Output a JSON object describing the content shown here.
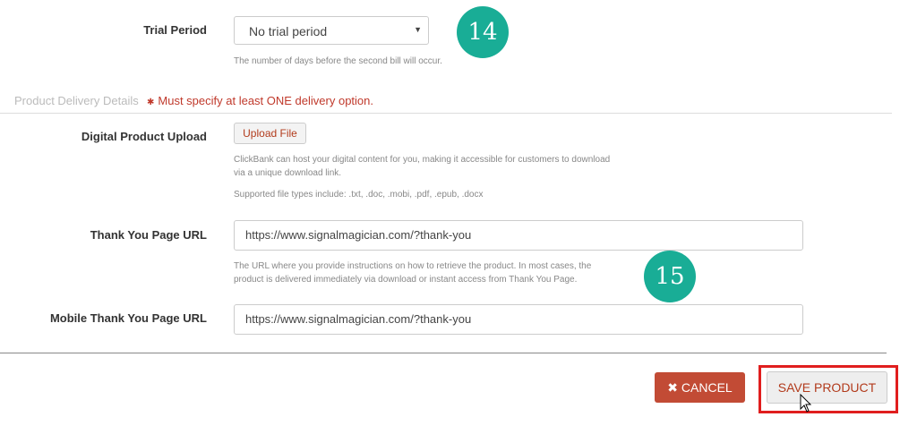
{
  "trial": {
    "label": "Trial Period",
    "selected": "No trial period",
    "help": "The number of days before the second bill will occur.",
    "badge": "14"
  },
  "delivery": {
    "section_title": "Product Delivery Details",
    "required_note": "Must specify at least ONE delivery option."
  },
  "upload": {
    "label": "Digital Product Upload",
    "button": "Upload File",
    "help1": "ClickBank can host your digital content for you, making it accessible for customers to download",
    "help2": "via a unique download link.",
    "help3": "Supported file types include: .txt, .doc, .mobi, .pdf, .epub, .docx"
  },
  "thank_you": {
    "label": "Thank You Page URL",
    "value": "https://www.signalmagician.com/?thank-you",
    "help1": "The URL where you provide instructions on how to retrieve the product. In most cases, the",
    "help2": "product is delivered immediately via download or instant access from Thank You Page.",
    "badge": "15"
  },
  "mobile_thank_you": {
    "label": "Mobile Thank You Page URL",
    "value": "https://www.signalmagician.com/?thank-you"
  },
  "actions": {
    "cancel": "CANCEL",
    "cancel_icon": "✖",
    "save": "SAVE PRODUCT"
  },
  "colors": {
    "badge": "#19ad96",
    "cancel": "#c24b35",
    "highlight": "#e01e1e",
    "required": "#c0392b"
  }
}
